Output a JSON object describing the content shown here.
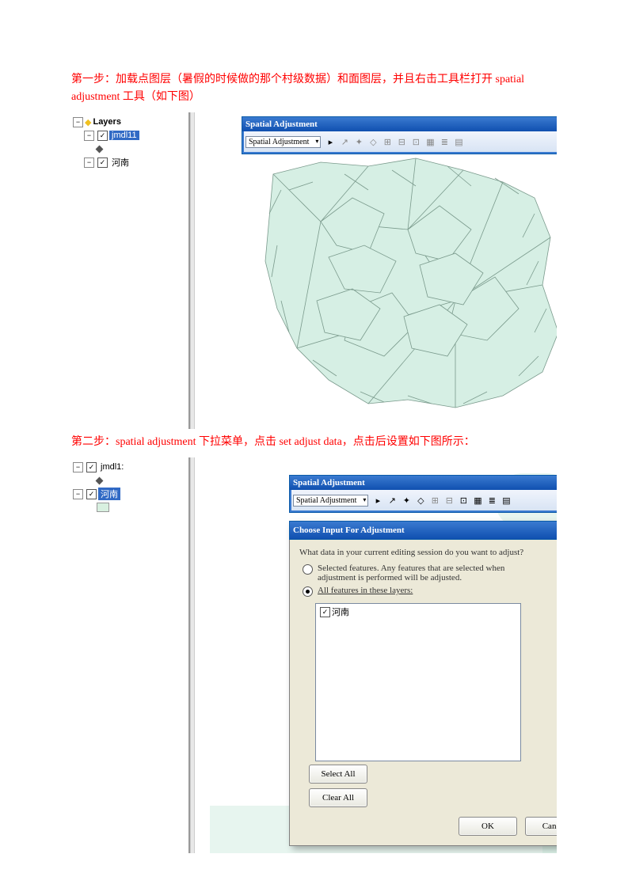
{
  "step1_text": "第一步：加载点图层（暑假的时候做的那个村级数据）和面图层，并且右击工具栏打开 spatial adjustment 工具（如下图）",
  "step2_text": "第二步：spatial adjustment 下拉菜单，点击 set adjust data，点击后设置如下图所示：",
  "toc": {
    "layers_label": "Layers",
    "layer1": "jmdl11",
    "layer2": "河南",
    "layer2_alt": "jmdl1:"
  },
  "toolbar": {
    "title": "Spatial Adjustment",
    "dropdown": "Spatial Adjustment",
    "close": "×"
  },
  "dialog": {
    "title": "Choose Input For Adjustment",
    "question": "What data in your current editing session do you want to adjust?",
    "opt1_a": "Selected features.  Any features that are selected when",
    "opt1_b": "adjustment is performed will be adjusted.",
    "opt2": "All features in these layers:",
    "item": "河南",
    "select_all": "Select All",
    "clear_all": "Clear All",
    "ok": "OK",
    "cancel": "Cancel",
    "help": "?",
    "close": "×"
  },
  "check": "✓"
}
